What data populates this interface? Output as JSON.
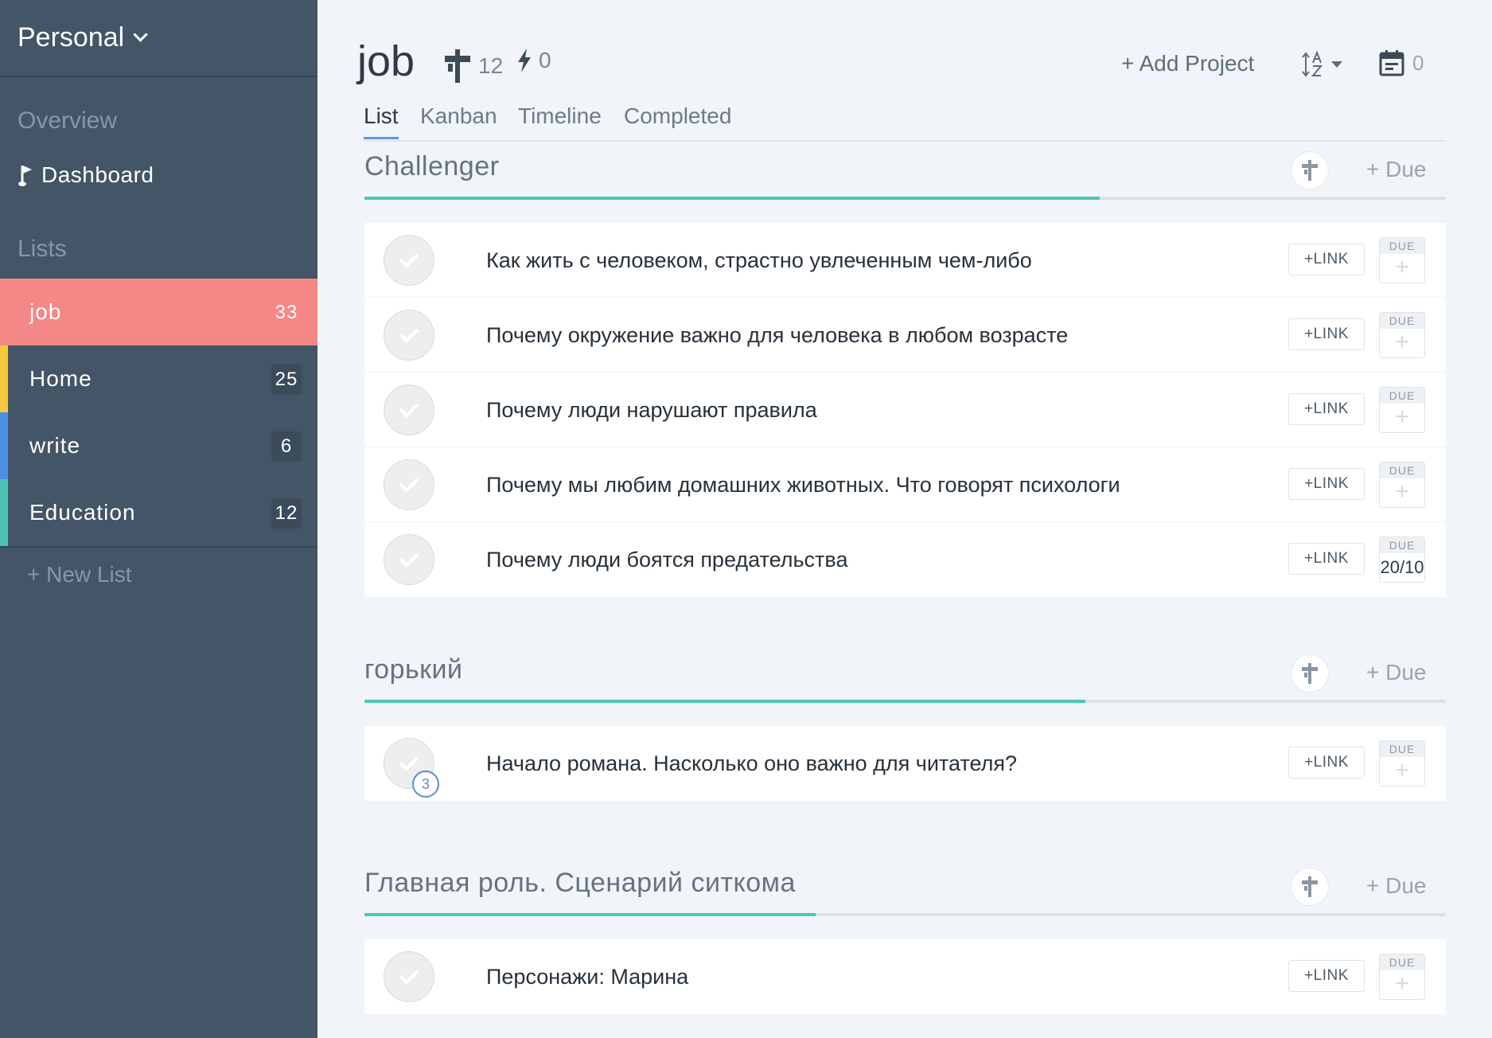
{
  "sidebar": {
    "workspace": "Personal",
    "overview_label": "Overview",
    "dashboard_label": "Dashboard",
    "lists_label": "Lists",
    "lists": [
      {
        "name": "job",
        "count": "33",
        "color": "#f38886",
        "active": true
      },
      {
        "name": "Home",
        "count": "25",
        "color": "#f5c842"
      },
      {
        "name": "write",
        "count": "6",
        "color": "#4a90e2"
      },
      {
        "name": "Education",
        "count": "12",
        "color": "#4fc1b0"
      }
    ],
    "new_list_label": "+ New List"
  },
  "header": {
    "title": "job",
    "projects_count": "12",
    "bolt_count": "0",
    "add_project_label": "+ Add Project",
    "calendar_count": "0"
  },
  "tabs": [
    "List",
    "Kanban",
    "Timeline",
    "Completed"
  ],
  "groups": [
    {
      "title": "Challenger",
      "due_label": "+ Due",
      "progress": 0.68,
      "tasks": [
        {
          "text": "Как жить с человеком, страстно увлеченным чем-либо",
          "due": ""
        },
        {
          "text": "Почему окружение важно для человека в любом возрасте",
          "due": ""
        },
        {
          "text": "Почему люди нарушают правила",
          "due": ""
        },
        {
          "text": "Почему мы любим домашних животных. Что говорят психологи",
          "due": ""
        },
        {
          "text": "Почему люди боятся предательства",
          "due": "20/10"
        }
      ]
    },
    {
      "title": "горький",
      "due_label": "+ Due",
      "progress": 0.667,
      "tasks": [
        {
          "text": "Начало романа. Насколько оно важно для читателя?",
          "due": "",
          "subtasks": "3"
        }
      ]
    },
    {
      "title": "Главная роль. Сценарий ситкома",
      "due_label": "+ Due",
      "progress": 0.417,
      "tasks": [
        {
          "text": "Персонажи: Марина",
          "due": ""
        }
      ]
    }
  ],
  "labels": {
    "link": "+LINK",
    "due": "DUE"
  }
}
